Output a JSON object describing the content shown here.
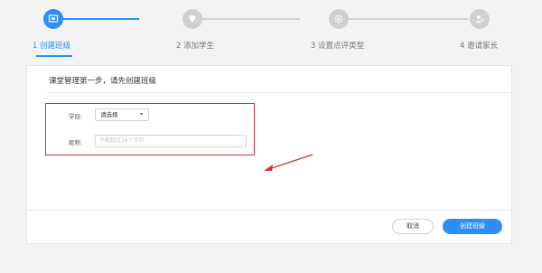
{
  "steps": [
    {
      "label": "1 创建班级",
      "icon": "screen-icon",
      "active": true
    },
    {
      "label": "2 添加学生",
      "icon": "diamond-icon",
      "active": false
    },
    {
      "label": "3 设置点评类型",
      "icon": "gear-icon",
      "active": false
    },
    {
      "label": "4 邀请家长",
      "icon": "add-user-icon",
      "active": false
    }
  ],
  "card": {
    "title": "课堂管理第一步，请先创建班级"
  },
  "form": {
    "grade_label": "学段:",
    "grade_value": "请选择",
    "name_label": "昵称:",
    "name_placeholder": "不能超过16个字符"
  },
  "footer": {
    "cancel_label": "取消",
    "create_label": "创建班级"
  },
  "colors": {
    "accent": "#2c8ef8",
    "highlight": "#d53030",
    "inactive": "#d0d0d0"
  }
}
